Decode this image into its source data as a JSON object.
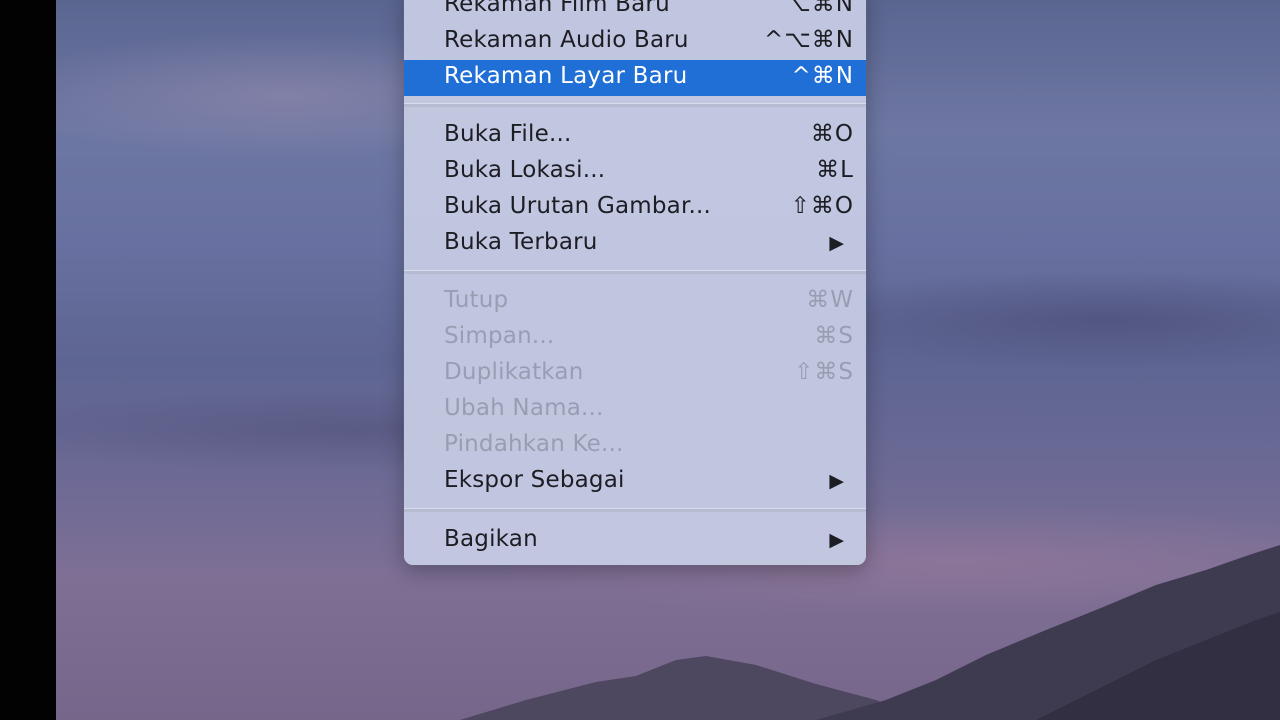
{
  "menu": {
    "items": [
      {
        "label": "Rekaman Film Baru",
        "shortcut": "⌥⌘N",
        "enabled": true
      },
      {
        "label": "Rekaman Audio Baru",
        "shortcut": "^⌥⌘N",
        "enabled": true
      },
      {
        "label": "Rekaman Layar Baru",
        "shortcut": "^⌘N",
        "enabled": true,
        "highlighted": true
      },
      {
        "label": "Buka File...",
        "shortcut": "⌘O",
        "enabled": true
      },
      {
        "label": "Buka Lokasi...",
        "shortcut": "⌘L",
        "enabled": true
      },
      {
        "label": "Buka Urutan Gambar...",
        "shortcut": "⇧⌘O",
        "enabled": true
      },
      {
        "label": "Buka Terbaru",
        "submenu": "▶",
        "enabled": true
      },
      {
        "label": "Tutup",
        "shortcut": "⌘W",
        "enabled": false
      },
      {
        "label": "Simpan...",
        "shortcut": "⌘S",
        "enabled": false
      },
      {
        "label": "Duplikatkan",
        "shortcut": "⇧⌘S",
        "enabled": false
      },
      {
        "label": "Ubah Nama...",
        "enabled": false
      },
      {
        "label": "Pindahkan Ke...",
        "enabled": false
      },
      {
        "label": "Ekspor Sebagai",
        "submenu": "▶",
        "enabled": true
      },
      {
        "label": "Bagikan",
        "submenu": "▶",
        "enabled": true
      }
    ]
  },
  "colors": {
    "highlight": "#1f6fd6",
    "menu_background": "#c4c9e2",
    "disabled_text": "#9a9db2"
  }
}
